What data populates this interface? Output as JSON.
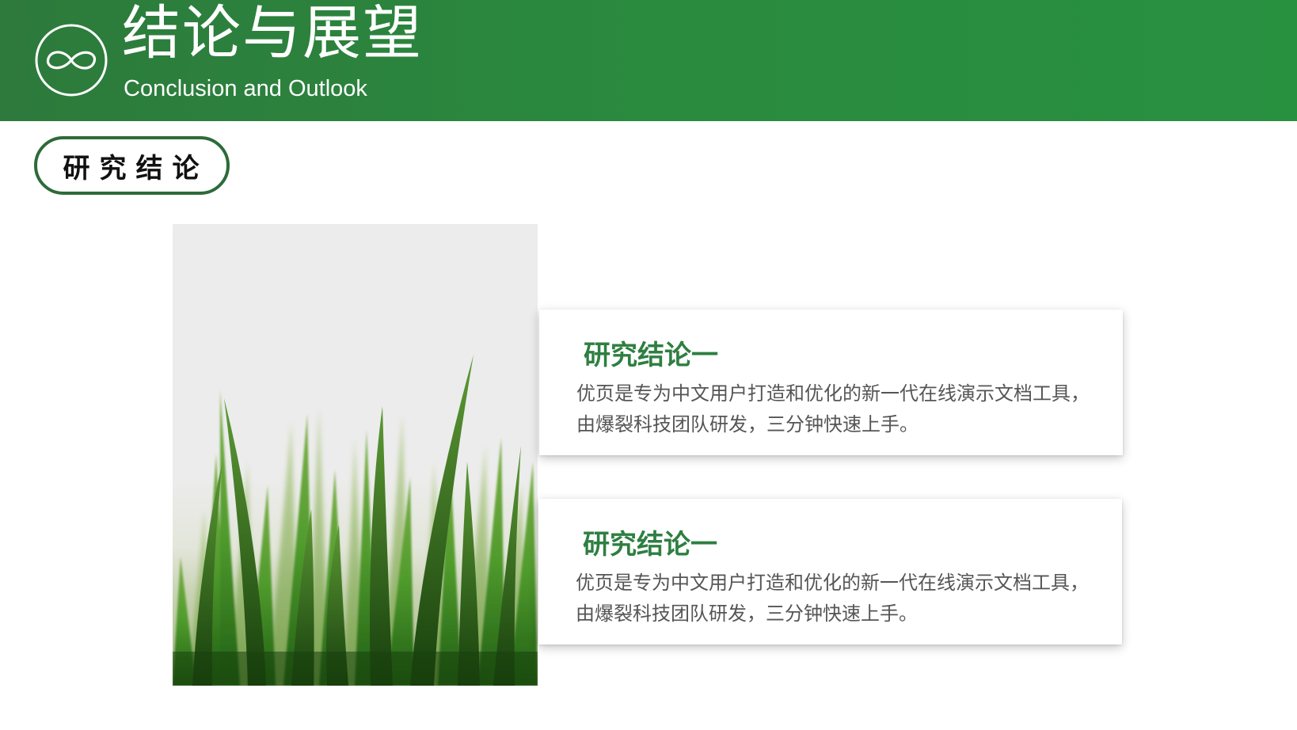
{
  "header": {
    "title": "结论与展望",
    "subtitle": "Conclusion and Outlook",
    "logo_icon": "infinity-icon",
    "background_color": "#2a8a3e"
  },
  "section": {
    "label": "研究结论",
    "border_color": "#2d6b3a"
  },
  "photo": {
    "subject": "grass-photo",
    "accent_color": "#3f8a2a"
  },
  "cards": [
    {
      "title": "研究结论一",
      "text": "优页是专为中文用户打造和优化的新一代在线演示文档工具，由爆裂科技团队研发，三分钟快速上手。"
    },
    {
      "title": "研究结论一",
      "text": "优页是专为中文用户打造和优化的新一代在线演示文档工具，由爆裂科技团队研发，三分钟快速上手。"
    }
  ],
  "colors": {
    "accent": "#2e7f41",
    "body_text": "#555555"
  }
}
